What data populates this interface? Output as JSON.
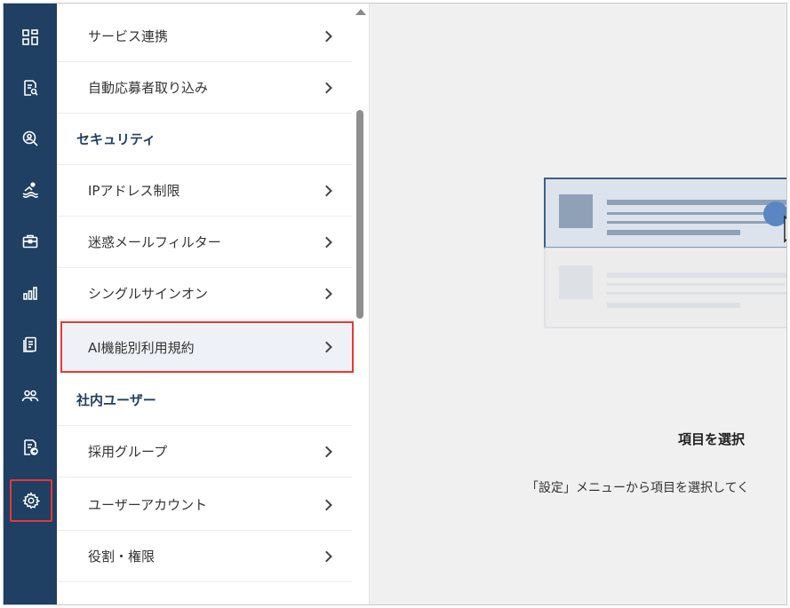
{
  "rail": {
    "icons": [
      "dashboard-icon",
      "search-document-icon",
      "person-search-icon",
      "swimmer-icon",
      "briefcase-icon",
      "bar-chart-icon",
      "document-list-icon",
      "people-icon",
      "document-arrow-icon",
      "gear-icon"
    ],
    "active": "gear-icon",
    "color": "#1f3f63"
  },
  "menu": {
    "items_top": [
      {
        "label": "サービス連携"
      },
      {
        "label": "自動応募者取り込み"
      }
    ],
    "section_security": "セキュリティ",
    "items_security": [
      {
        "label": "IPアドレス制限"
      },
      {
        "label": "迷惑メールフィルター"
      },
      {
        "label": "シングルサインオン"
      },
      {
        "label": "AI機能別利用規約"
      }
    ],
    "section_internal": "社内ユーザー",
    "items_internal": [
      {
        "label": "採用グループ"
      },
      {
        "label": "ユーザーアカウント"
      },
      {
        "label": "役割・権限"
      }
    ],
    "highlighted": "AI機能別利用規約"
  },
  "content": {
    "title": "項目を選択",
    "description": "「設定」メニューから項目を選択してく"
  },
  "colors": {
    "accent": "#1f3f63",
    "highlight_border": "#e53935"
  }
}
